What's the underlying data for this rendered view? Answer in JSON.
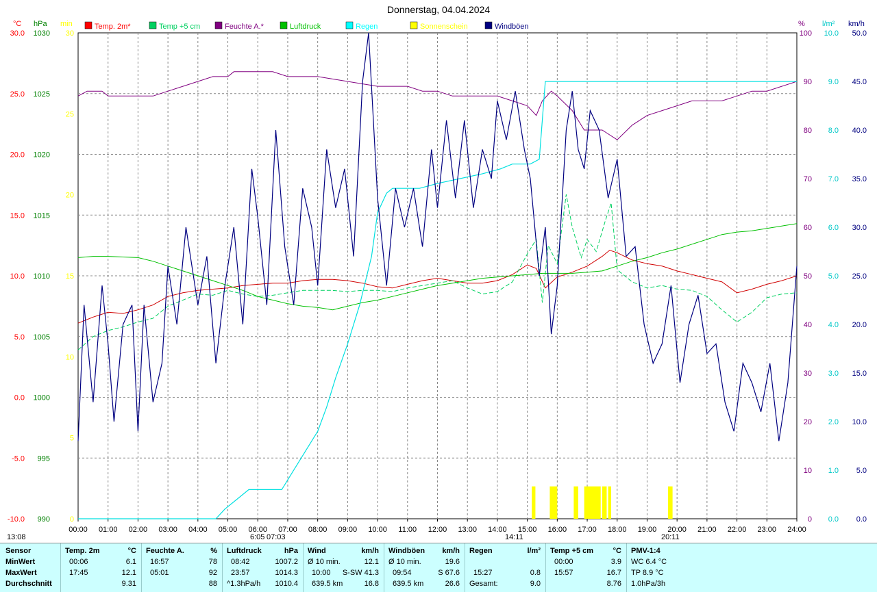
{
  "title": "Donnerstag, 04.04.2024",
  "chart_data": {
    "type": "line",
    "x_start_label": "00:00",
    "x_tick_labels": [
      "00:00",
      "01:00",
      "02:00",
      "03:00",
      "04:00",
      "05:00",
      "06:00",
      "07:00",
      "08:00",
      "09:00",
      "10:00",
      "11:00",
      "12:00",
      "13:00",
      "14:00",
      "15:00",
      "16:00",
      "17:00",
      "18:00",
      "19:00",
      "20:00",
      "21:00",
      "22:00",
      "23:00",
      "24:00"
    ],
    "x_range_hours": [
      0,
      24
    ],
    "grid": true,
    "legend_position": "top",
    "axes": {
      "temp": {
        "unit": "°C",
        "range": [
          -10,
          30
        ],
        "ticks": [
          "30.0",
          "25.0",
          "20.0",
          "15.0",
          "10.0",
          "5.0",
          "0.0",
          "-5.0",
          "-10.0"
        ],
        "color": "#ff0000"
      },
      "pressure": {
        "unit": "hPa",
        "range": [
          990,
          1030
        ],
        "ticks": [
          "1030",
          "1025",
          "1020",
          "1015",
          "1010",
          "1005",
          "1000",
          "995",
          "990"
        ],
        "color": "#008000"
      },
      "sun": {
        "unit": "min",
        "range": [
          0,
          30
        ],
        "ticks": [
          "30",
          "25",
          "20",
          "15",
          "10",
          "5",
          "0"
        ],
        "color": "#ffff00"
      },
      "humidity": {
        "unit": "%",
        "range": [
          0,
          100
        ],
        "ticks": [
          "100",
          "90",
          "80",
          "70",
          "60",
          "50",
          "40",
          "30",
          "20",
          "10",
          "0"
        ],
        "color": "#800080"
      },
      "rain": {
        "unit": "l/m²",
        "range": [
          0,
          10
        ],
        "ticks": [
          "10.0",
          "9.0",
          "8.0",
          "7.0",
          "6.0",
          "5.0",
          "4.0",
          "3.0",
          "2.0",
          "1.0",
          "0.0"
        ],
        "color": "#00c8c8"
      },
      "wind": {
        "unit": "km/h",
        "range": [
          0,
          50
        ],
        "ticks": [
          "50.0",
          "45.0",
          "40.0",
          "35.0",
          "30.0",
          "25.0",
          "20.0",
          "15.0",
          "10.0",
          "5.0",
          "0.0"
        ],
        "color": "#000080"
      }
    },
    "legend": [
      {
        "name": "Temp. 2m*",
        "color": "#ff0000"
      },
      {
        "name": "Temp +5 cm",
        "color": "#00d060"
      },
      {
        "name": "Feuchte A.*",
        "color": "#800080"
      },
      {
        "name": "Luftdruck",
        "color": "#00c000"
      },
      {
        "name": "Regen",
        "color": "#00ffff"
      },
      {
        "name": "Sonnenschein",
        "color": "#ffff00"
      },
      {
        "name": "Windböen",
        "color": "#000080"
      }
    ],
    "series": [
      {
        "name": "Temp. 2m*",
        "axis": "temp",
        "x": [
          0,
          0.5,
          1,
          1.5,
          2,
          2.5,
          3,
          3.5,
          4,
          4.5,
          5,
          5.5,
          6,
          6.5,
          7,
          7.5,
          8,
          8.5,
          9,
          9.5,
          10,
          10.5,
          11,
          11.5,
          12,
          12.5,
          13,
          13.5,
          14,
          14.5,
          15,
          15.3,
          15.6,
          16,
          16.5,
          17,
          17.5,
          17.75,
          18,
          18.5,
          19,
          19.5,
          20,
          20.5,
          21,
          21.5,
          22,
          22.5,
          23,
          23.5,
          24
        ],
        "y": [
          6.1,
          6.6,
          7.0,
          6.9,
          7.2,
          7.6,
          8.3,
          8.6,
          8.8,
          8.9,
          9.0,
          9.2,
          9.3,
          9.4,
          9.4,
          9.6,
          9.7,
          9.7,
          9.6,
          9.4,
          9.1,
          9.0,
          9.3,
          9.6,
          9.8,
          9.6,
          9.4,
          9.4,
          9.6,
          10.1,
          10.9,
          10.6,
          9.0,
          9.9,
          10.3,
          10.8,
          11.6,
          12.1,
          11.9,
          11.3,
          11.0,
          10.8,
          10.4,
          10.1,
          9.8,
          9.5,
          8.6,
          8.9,
          9.3,
          9.6,
          10.0
        ]
      },
      {
        "name": "Temp +5 cm",
        "axis": "temp",
        "x": [
          0,
          0.5,
          1,
          1.5,
          2,
          2.5,
          3,
          3.5,
          4,
          4.5,
          5,
          5.5,
          6,
          6.5,
          7,
          7.5,
          8,
          8.5,
          9,
          9.5,
          10,
          10.5,
          11,
          11.5,
          12,
          12.5,
          13,
          13.5,
          14,
          14.5,
          15,
          15.3,
          15.5,
          15.7,
          16,
          16.3,
          16.5,
          16.8,
          17,
          17.3,
          17.6,
          17.8,
          18,
          18.5,
          19,
          19.5,
          20,
          20.5,
          21,
          21.5,
          22,
          22.5,
          23,
          23.5,
          24
        ],
        "y": [
          3.9,
          5.0,
          5.5,
          5.8,
          6.2,
          6.5,
          7.5,
          8.0,
          8.5,
          8.4,
          8.8,
          8.5,
          8.3,
          8.4,
          8.6,
          8.8,
          8.8,
          8.8,
          8.7,
          8.8,
          8.8,
          8.7,
          9.0,
          9.2,
          9.4,
          9.6,
          9.0,
          8.5,
          8.7,
          9.5,
          11.8,
          13.0,
          7.8,
          12.5,
          11.0,
          16.7,
          14.0,
          11.5,
          13.0,
          12.0,
          14.5,
          16.0,
          10.5,
          9.5,
          9.0,
          9.2,
          8.9,
          8.8,
          8.3,
          7.2,
          6.2,
          7.0,
          8.2,
          8.5,
          8.6
        ]
      },
      {
        "name": "Feuchte A.*",
        "axis": "humidity",
        "x": [
          0,
          0.3,
          0.8,
          1,
          2,
          2.5,
          3,
          3.5,
          4,
          4.5,
          5,
          5.2,
          6,
          6.5,
          7,
          8,
          9,
          10,
          10.5,
          11,
          11.5,
          12,
          12.5,
          13,
          13.5,
          14,
          14.5,
          15,
          15.3,
          15.5,
          15.8,
          16,
          16.5,
          16.9,
          17.5,
          18,
          18.5,
          19,
          19.5,
          20,
          20.5,
          21,
          21.5,
          22,
          22.5,
          23,
          23.5,
          24
        ],
        "y": [
          87,
          88,
          88,
          87,
          87,
          87,
          88,
          89,
          90,
          91,
          91,
          92,
          92,
          92,
          91,
          91,
          90,
          89,
          89,
          89,
          88,
          88,
          87,
          87,
          87,
          87,
          86,
          85,
          83,
          86,
          88,
          87,
          84,
          80,
          80,
          78,
          81,
          83,
          84,
          85,
          86,
          86,
          86,
          87,
          88,
          88,
          89,
          90
        ]
      },
      {
        "name": "Luftdruck",
        "axis": "pressure",
        "x": [
          0,
          0.5,
          1,
          2,
          2.5,
          3,
          3.5,
          4,
          4.5,
          5,
          5.5,
          6,
          6.5,
          7,
          7.5,
          8,
          8.5,
          9,
          9.5,
          10,
          10.5,
          11,
          11.5,
          12,
          12.5,
          13,
          13.5,
          14,
          14.5,
          15,
          15.5,
          16,
          16.5,
          17,
          17.5,
          18,
          18.5,
          19,
          19.5,
          20,
          20.5,
          21,
          21.5,
          22,
          22.5,
          23,
          23.5,
          24
        ],
        "y": [
          1011.5,
          1011.6,
          1011.6,
          1011.5,
          1011.2,
          1010.8,
          1010.4,
          1010.0,
          1009.6,
          1009.2,
          1008.8,
          1008.3,
          1008.0,
          1007.7,
          1007.5,
          1007.4,
          1007.2,
          1007.5,
          1007.8,
          1008.0,
          1008.3,
          1008.6,
          1008.9,
          1009.2,
          1009.4,
          1009.6,
          1009.8,
          1009.9,
          1010.0,
          1010.1,
          1010.2,
          1010.2,
          1010.2,
          1010.3,
          1010.4,
          1010.8,
          1011.2,
          1011.5,
          1011.9,
          1012.2,
          1012.6,
          1013.0,
          1013.4,
          1013.6,
          1013.7,
          1013.9,
          1014.1,
          1014.3
        ]
      },
      {
        "name": "Regen",
        "axis": "rain",
        "x": [
          0,
          4.6,
          4.9,
          5.3,
          5.7,
          6.8,
          7.1,
          7.5,
          8,
          8.3,
          8.6,
          9,
          9.4,
          9.8,
          10,
          10.3,
          10.5,
          10.8,
          11.4,
          12,
          13.5,
          14.1,
          14.5,
          15.1,
          15.4,
          15.6,
          16,
          24
        ],
        "y": [
          0,
          0,
          0.2,
          0.4,
          0.6,
          0.6,
          0.9,
          1.3,
          1.8,
          2.3,
          2.9,
          3.6,
          4.4,
          5.4,
          6.3,
          6.7,
          6.8,
          6.8,
          6.8,
          6.9,
          7.1,
          7.2,
          7.3,
          7.3,
          7.4,
          9.0,
          9.0,
          9.0
        ]
      },
      {
        "name": "Windböen",
        "axis": "wind",
        "x": [
          0,
          0.2,
          0.5,
          0.8,
          1,
          1.2,
          1.5,
          1.8,
          2,
          2.2,
          2.5,
          2.8,
          3,
          3.3,
          3.6,
          4,
          4.3,
          4.6,
          4.9,
          5.2,
          5.5,
          5.8,
          6,
          6.3,
          6.6,
          6.9,
          7.2,
          7.5,
          7.8,
          8,
          8.3,
          8.6,
          8.9,
          9.2,
          9.5,
          9.7,
          10,
          10.3,
          10.6,
          10.9,
          11.2,
          11.5,
          11.8,
          12,
          12.3,
          12.6,
          12.9,
          13.2,
          13.5,
          13.8,
          14,
          14.3,
          14.6,
          14.9,
          15.1,
          15.4,
          15.6,
          15.8,
          16,
          16.3,
          16.5,
          16.7,
          16.9,
          17.1,
          17.4,
          17.7,
          18,
          18.3,
          18.6,
          18.9,
          19.2,
          19.5,
          19.8,
          20.1,
          20.4,
          20.7,
          21,
          21.3,
          21.6,
          21.9,
          22.2,
          22.5,
          22.8,
          23.1,
          23.4,
          23.7,
          24
        ],
        "y": [
          8,
          22,
          12,
          24,
          18,
          10,
          20,
          22,
          9,
          22,
          12,
          16,
          26,
          20,
          30,
          22,
          27,
          16,
          24,
          30,
          20,
          36,
          31,
          22,
          40,
          28,
          22,
          34,
          30,
          24,
          38,
          32,
          36,
          27,
          45,
          67.6,
          33,
          24,
          34,
          30,
          34,
          28,
          38,
          32,
          41,
          33,
          41,
          32,
          38,
          35,
          43,
          39,
          44,
          38,
          35,
          25,
          30,
          19,
          24,
          40,
          44,
          38,
          36,
          42,
          40,
          33,
          37,
          27,
          28,
          20,
          16,
          18,
          24,
          14,
          20,
          23,
          17,
          18,
          12,
          9,
          16,
          14,
          11,
          16,
          8,
          14,
          26
        ]
      }
    ],
    "sun_bars": [
      {
        "x": 15.15,
        "w": 0.12
      },
      {
        "x": 15.75,
        "w": 0.25
      },
      {
        "x": 16.55,
        "w": 0.15
      },
      {
        "x": 16.9,
        "w": 0.55
      },
      {
        "x": 17.5,
        "w": 0.15
      },
      {
        "x": 17.7,
        "w": 0.1
      },
      {
        "x": 19.7,
        "w": 0.15
      }
    ],
    "sun_bar_value_min": 2,
    "sun_markers": {
      "sunrise": "07:03",
      "sunrise_pre": "6:05",
      "noon": "14:11",
      "sunset": "20:11",
      "left_time": "13:08"
    }
  },
  "stats": {
    "row_labels": [
      "Sensor",
      "MinWert",
      "MaxWert",
      "Durchschnitt"
    ],
    "temp2m": {
      "title": "Temp. 2m",
      "unit": "°C",
      "min_time": "00:06",
      "min": "6.1",
      "max_time": "17:45",
      "max": "12.1",
      "avg": "9.31"
    },
    "feuchte": {
      "title": "Feuchte A.",
      "unit": "%",
      "min_time": "16:57",
      "min": "78",
      "max_time": "05:01",
      "max": "92",
      "avg": "88"
    },
    "luftdruck": {
      "title": "Luftdruck",
      "unit": "hPa",
      "min_time": "08:42",
      "min": "1007.2",
      "max_time": "23:57",
      "max": "1014.3",
      "trend": "^1.3hPa/h",
      "avg": "1010.4"
    },
    "wind": {
      "title": "Wind",
      "unit": "km/h",
      "r1_label": "Ø 10 min.",
      "r1_val": "12.1",
      "r2_time": "10:00",
      "r2_val": "S-SW 41.3",
      "r3_label": "639.5 km",
      "r3_val": "16.8"
    },
    "windboeen": {
      "title": "Windböen",
      "unit": "km/h",
      "r1_label": "Ø 10 min.",
      "r1_val": "19.6",
      "r2_time": "09:54",
      "r2_val": "S 67.6",
      "r3_label": "639.5 km",
      "r3_val": "26.6"
    },
    "regen": {
      "title": "Regen",
      "unit": "l/m²",
      "r2_time": "15:27",
      "r2_val": "0.8",
      "r3_label": "Gesamt:",
      "r3_val": "9.0"
    },
    "temp5cm": {
      "title": "Temp +5 cm",
      "unit": "°C",
      "min_time": "00:00",
      "min": "3.9",
      "max_time": "15:57",
      "max": "16.7",
      "avg": "8.76"
    },
    "pmv": {
      "title": "PMV-1:4",
      "wc": "WC 6.4 °C",
      "tp": "TP 8.9 °C",
      "trend": "1.0hPa/3h"
    }
  }
}
